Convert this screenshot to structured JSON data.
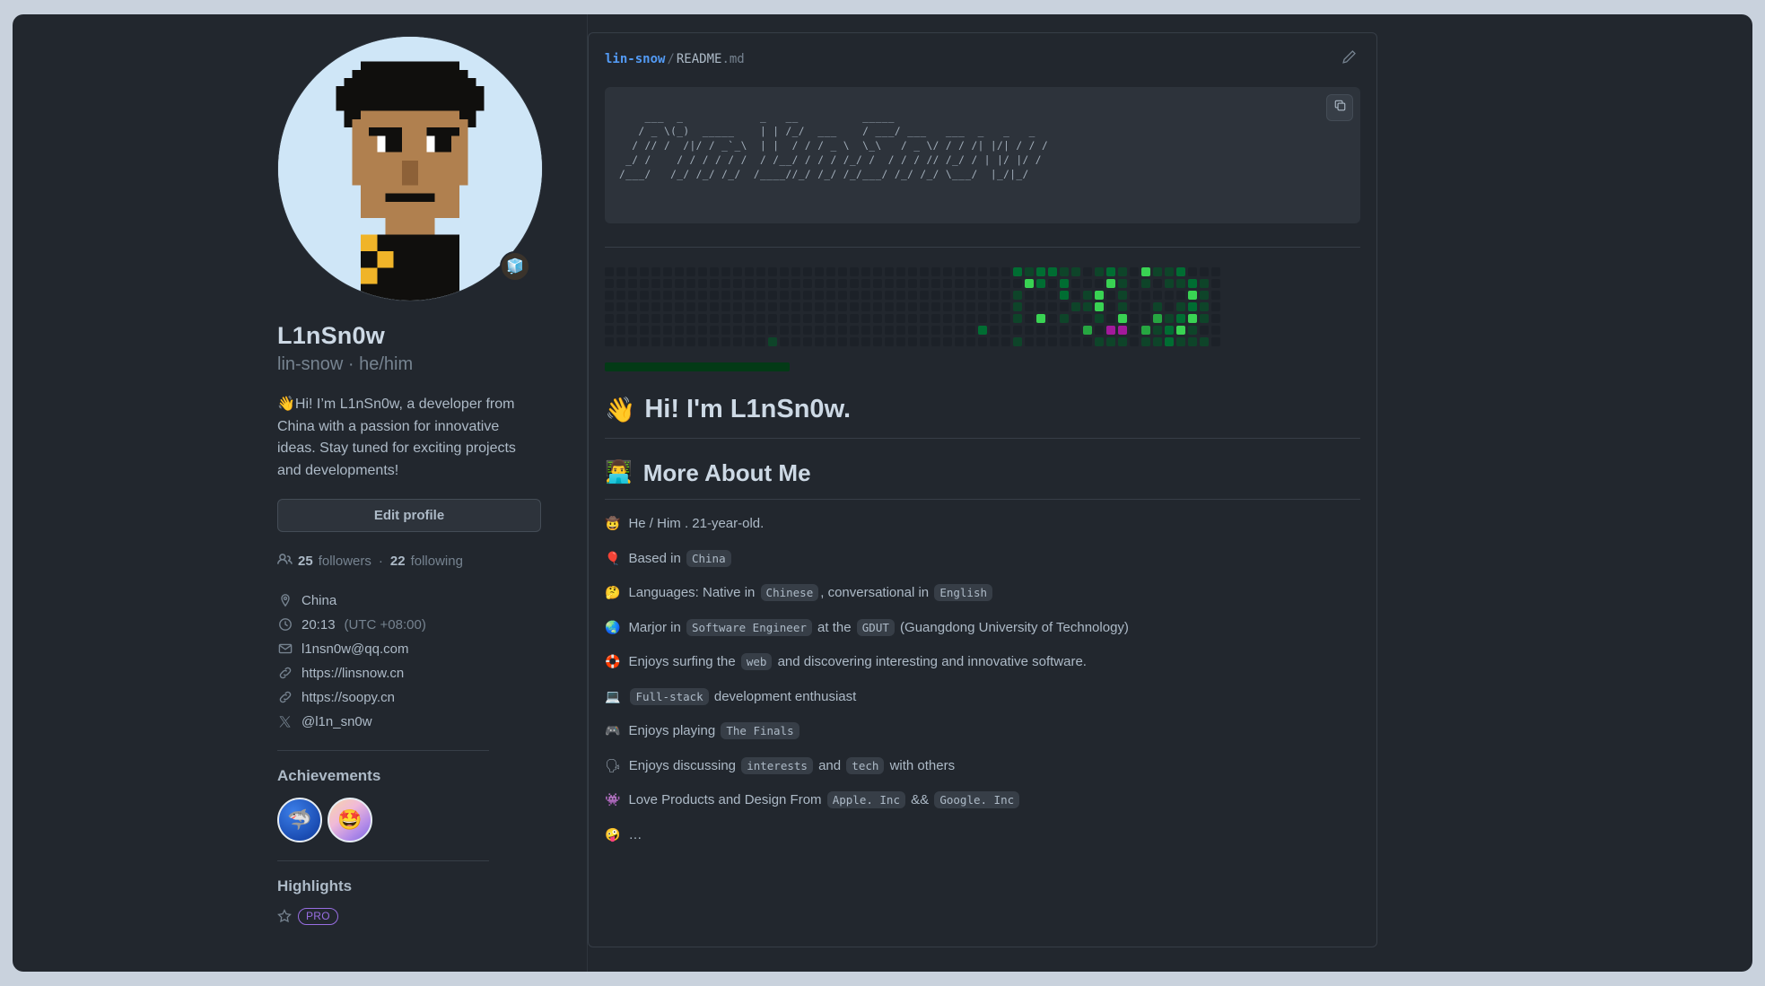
{
  "profile": {
    "avatar_alt": "pixel-art avatar",
    "status_emoji": "🧊",
    "full_name": "L1nSn0w",
    "login_line": "lin-snow · he/him",
    "bio": "👋Hi! I’m L1nSn0w, a developer from China with a passion for innovative ideas. Stay tuned for exciting projects and developments!",
    "edit_button": "Edit profile",
    "followers_count": "25",
    "followers_label": "followers",
    "following_count": "22",
    "following_label": "following",
    "separator": "·",
    "details": [
      {
        "icon": "location-icon",
        "text": "China",
        "muted": ""
      },
      {
        "icon": "clock-icon",
        "text": "20:13",
        "muted": "(UTC +08:00)"
      },
      {
        "icon": "mail-icon",
        "text": "l1nsn0w@qq.com",
        "muted": ""
      },
      {
        "icon": "link-icon",
        "text": "https://linsnow.cn",
        "muted": ""
      },
      {
        "icon": "link-icon",
        "text": "https://soopy.cn",
        "muted": ""
      },
      {
        "icon": "x-icon",
        "text": "@l1n_sn0w",
        "muted": ""
      }
    ],
    "achievements_title": "Achievements",
    "achievements": [
      {
        "name": "pull-shark-badge",
        "emoji": "🦈"
      },
      {
        "name": "starstruck-badge",
        "emoji": "🤩"
      }
    ],
    "highlights_title": "Highlights",
    "highlight_badge": "PRO"
  },
  "readme": {
    "breadcrumb": {
      "owner": "lin-snow",
      "slash": "/",
      "file": "README",
      "ext": ".md"
    },
    "edit_icon": "pencil-icon",
    "copy_icon": "copy-icon",
    "ascii_art": "    ___  _            _   __          _____                      \n   / _ \\(_)  _____    | | /_/  ___    / ___/ ___   ___  _   _   _ \n  / // /  /|/ / _`_\\  | |  / / / _ \\  \\_\\   / _ \\/ / / /| |/| / / /\n _/ /    / / / / / /  / /__/ / / / /_/ /  / / / // /_/ / | |/ |/ /\n/___/   /_/ /_/ /_/  /____//_/ /_/ /_/___/ /_/ /_/ \\___/  |_/|_/  ",
    "h1": {
      "emoji": "👋",
      "text": "Hi! I'm L1nSn0w."
    },
    "h2": {
      "emoji": "👨‍💻",
      "text": "More About Me"
    },
    "about_items": [
      {
        "emoji": "🤠",
        "parts": [
          {
            "t": "text",
            "v": "He / Him . 21-year-old."
          }
        ]
      },
      {
        "emoji": "🎈",
        "parts": [
          {
            "t": "text",
            "v": "Based in "
          },
          {
            "t": "code",
            "v": "China"
          }
        ]
      },
      {
        "emoji": "🤔",
        "parts": [
          {
            "t": "text",
            "v": "Languages: Native in "
          },
          {
            "t": "code",
            "v": "Chinese"
          },
          {
            "t": "text",
            "v": ", conversational in "
          },
          {
            "t": "code",
            "v": "English"
          }
        ]
      },
      {
        "emoji": "🌏",
        "parts": [
          {
            "t": "text",
            "v": "Marjor in "
          },
          {
            "t": "code",
            "v": "Software Engineer"
          },
          {
            "t": "text",
            "v": " at the "
          },
          {
            "t": "code",
            "v": "GDUT"
          },
          {
            "t": "text",
            "v": " (Guangdong University of Technology)"
          }
        ]
      },
      {
        "emoji": "🛟",
        "parts": [
          {
            "t": "text",
            "v": "Enjoys surfing the "
          },
          {
            "t": "code",
            "v": "web"
          },
          {
            "t": "text",
            "v": " and discovering interesting and innovative software."
          }
        ]
      },
      {
        "emoji": "💻",
        "parts": [
          {
            "t": "code",
            "v": "Full-stack"
          },
          {
            "t": "text",
            "v": " development enthusiast"
          }
        ]
      },
      {
        "emoji": "🎮",
        "parts": [
          {
            "t": "text",
            "v": "Enjoys playing "
          },
          {
            "t": "code",
            "v": "The Finals"
          }
        ]
      },
      {
        "emoji": "🗣",
        "parts": [
          {
            "t": "text",
            "v": "Enjoys discussing "
          },
          {
            "t": "code",
            "v": "interests"
          },
          {
            "t": "text",
            "v": " and "
          },
          {
            "t": "code",
            "v": "tech"
          },
          {
            "t": "text",
            "v": " with others"
          }
        ]
      },
      {
        "emoji": "👾",
        "parts": [
          {
            "t": "text",
            "v": "Love Products and Design From "
          },
          {
            "t": "code",
            "v": "Apple. Inc"
          },
          {
            "t": "text",
            "v": " && "
          },
          {
            "t": "code",
            "v": "Google. Inc"
          }
        ]
      },
      {
        "emoji": "🤪",
        "parts": [
          {
            "t": "text",
            "v": "…"
          }
        ]
      }
    ]
  },
  "contribution_graph": {
    "rows": 7,
    "columns": 53,
    "colors": {
      "empty": "#1c2128",
      "l1": "#0e4429",
      "l2": "#006d32",
      "l3": "#26a641",
      "l4": "#39d353",
      "special": "#a3199b"
    },
    "cells": [
      {
        "r": 6,
        "c": 14,
        "v": "l1"
      },
      {
        "r": 0,
        "c": 42,
        "v": "l1"
      },
      {
        "r": 0,
        "c": 43,
        "v": "l2"
      },
      {
        "r": 0,
        "c": 44,
        "v": "l1"
      },
      {
        "r": 1,
        "c": 43,
        "v": "l4"
      },
      {
        "r": 1,
        "c": 44,
        "v": "l1"
      },
      {
        "r": 2,
        "c": 42,
        "v": "l1"
      },
      {
        "r": 2,
        "c": 44,
        "v": "l1"
      },
      {
        "r": 3,
        "c": 42,
        "v": "l1"
      },
      {
        "r": 3,
        "c": 44,
        "v": "l1"
      },
      {
        "r": 4,
        "c": 42,
        "v": "l1"
      },
      {
        "r": 4,
        "c": 44,
        "v": "l4"
      },
      {
        "r": 5,
        "c": 41,
        "v": "l3"
      },
      {
        "r": 5,
        "c": 43,
        "v": "special"
      },
      {
        "r": 5,
        "c": 44,
        "v": "special"
      },
      {
        "r": 6,
        "c": 42,
        "v": "l1"
      },
      {
        "r": 0,
        "c": 35,
        "v": "l2"
      },
      {
        "r": 0,
        "c": 36,
        "v": "l1"
      },
      {
        "r": 0,
        "c": 37,
        "v": "l2"
      },
      {
        "r": 0,
        "c": 38,
        "v": "l2"
      },
      {
        "r": 0,
        "c": 39,
        "v": "l1"
      },
      {
        "r": 0,
        "c": 40,
        "v": "l1"
      },
      {
        "r": 0,
        "c": 46,
        "v": "l4"
      },
      {
        "r": 0,
        "c": 47,
        "v": "l1"
      },
      {
        "r": 0,
        "c": 48,
        "v": "l1"
      },
      {
        "r": 0,
        "c": 49,
        "v": "l2"
      },
      {
        "r": 1,
        "c": 36,
        "v": "l4"
      },
      {
        "r": 1,
        "c": 37,
        "v": "l2"
      },
      {
        "r": 1,
        "c": 39,
        "v": "l2"
      },
      {
        "r": 1,
        "c": 46,
        "v": "l1"
      },
      {
        "r": 1,
        "c": 48,
        "v": "l1"
      },
      {
        "r": 1,
        "c": 49,
        "v": "l1"
      },
      {
        "r": 1,
        "c": 50,
        "v": "l2"
      },
      {
        "r": 1,
        "c": 51,
        "v": "l1"
      },
      {
        "r": 2,
        "c": 35,
        "v": "l1"
      },
      {
        "r": 2,
        "c": 39,
        "v": "l2"
      },
      {
        "r": 2,
        "c": 41,
        "v": "l1"
      },
      {
        "r": 2,
        "c": 42,
        "v": "l4"
      },
      {
        "r": 2,
        "c": 50,
        "v": "l4"
      },
      {
        "r": 2,
        "c": 51,
        "v": "l1"
      },
      {
        "r": 3,
        "c": 35,
        "v": "l1"
      },
      {
        "r": 3,
        "c": 40,
        "v": "l1"
      },
      {
        "r": 3,
        "c": 41,
        "v": "l1"
      },
      {
        "r": 3,
        "c": 42,
        "v": "l4"
      },
      {
        "r": 3,
        "c": 47,
        "v": "l1"
      },
      {
        "r": 3,
        "c": 49,
        "v": "l1"
      },
      {
        "r": 3,
        "c": 50,
        "v": "l2"
      },
      {
        "r": 3,
        "c": 51,
        "v": "l1"
      },
      {
        "r": 4,
        "c": 35,
        "v": "l1"
      },
      {
        "r": 4,
        "c": 37,
        "v": "l4"
      },
      {
        "r": 4,
        "c": 39,
        "v": "l1"
      },
      {
        "r": 4,
        "c": 47,
        "v": "l3"
      },
      {
        "r": 4,
        "c": 48,
        "v": "l1"
      },
      {
        "r": 4,
        "c": 49,
        "v": "l2"
      },
      {
        "r": 4,
        "c": 50,
        "v": "l4"
      },
      {
        "r": 4,
        "c": 51,
        "v": "l1"
      },
      {
        "r": 5,
        "c": 32,
        "v": "l2"
      },
      {
        "r": 5,
        "c": 46,
        "v": "l3"
      },
      {
        "r": 5,
        "c": 47,
        "v": "l1"
      },
      {
        "r": 5,
        "c": 48,
        "v": "l2"
      },
      {
        "r": 5,
        "c": 49,
        "v": "l4"
      },
      {
        "r": 5,
        "c": 50,
        "v": "l1"
      },
      {
        "r": 6,
        "c": 35,
        "v": "l1"
      },
      {
        "r": 6,
        "c": 43,
        "v": "l1"
      },
      {
        "r": 6,
        "c": 44,
        "v": "l1"
      },
      {
        "r": 6,
        "c": 46,
        "v": "l1"
      },
      {
        "r": 6,
        "c": 47,
        "v": "l1"
      },
      {
        "r": 6,
        "c": 48,
        "v": "l2"
      },
      {
        "r": 6,
        "c": 49,
        "v": "l1"
      },
      {
        "r": 6,
        "c": 50,
        "v": "l1"
      },
      {
        "r": 6,
        "c": 51,
        "v": "l1"
      }
    ]
  }
}
